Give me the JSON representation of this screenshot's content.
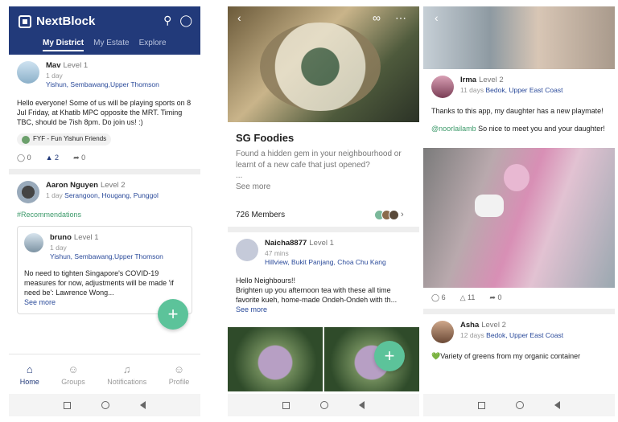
{
  "app": {
    "logo_text": "NextBlock",
    "tabs": [
      "My District",
      "My Estate",
      "Explore"
    ],
    "nav": [
      "Home",
      "Groups",
      "Notifications",
      "Profile"
    ],
    "fab_label": "+"
  },
  "phone1": {
    "post1": {
      "name": "Mav",
      "level": "Level 1",
      "time": "1 day",
      "location": "Yishun, Sembawang,Upper Thomson",
      "text": "Hello everyone! Some of us will be playing sports on 8 Jul Friday, at Khatib MPC opposite the MRT. Timing TBC, should be 7ish 8pm. Do join us! :)",
      "group": "FYF - Fun Yishun Friends",
      "comments": "0",
      "likes": "2",
      "shares": "0"
    },
    "post2": {
      "name": "Aaron Nguyen",
      "level": "Level 2",
      "time": "1 day",
      "location": "Serangoon, Hougang, Punggol",
      "hashtag": "#Recommendations",
      "inner": {
        "name": "bruno",
        "level": "Level 1",
        "time": "1 day",
        "location": "Yishun, Sembawang,Upper Thomson",
        "text": "No need to tighten Singapore's COVID-19 measures for now, adjustments will be made 'if need be': Lawrence Wong...",
        "see_more": "See more"
      }
    }
  },
  "phone2": {
    "group_title": "SG Foodies",
    "group_desc": "Found a hidden gem in your neighbourhood or learnt of a new cafe that just opened?",
    "ellipsis": "...",
    "see_more": "See more",
    "members": "726 Members",
    "post": {
      "name": "Naicha8877",
      "level": "Level 1",
      "time": "47 mins",
      "location": "Hillview, Bukit Panjang, Choa Chu Kang",
      "text1": "Hello Neighbours!!",
      "text2": "Brighten up you afternoon tea with these all time favorite kueh, home-made Ondeh-Ondeh with th...",
      "see_more": "See more"
    }
  },
  "phone3": {
    "post1": {
      "name": "Irma",
      "level": "Level 2",
      "time": "11 days",
      "location": "Bedok, Upper East Coast",
      "text": "Thanks to this app, my daughter has a new playmate!",
      "mention": "@noorlailamb",
      "reply": " So nice to meet you and your daughter!",
      "comments": "6",
      "likes": "11",
      "shares": "0"
    },
    "post2": {
      "name": "Asha",
      "level": "Level 2",
      "time": "12 days",
      "location": "Bedok, Upper East Coast",
      "text": "💚Variety of greens from my organic container"
    }
  },
  "colors": {
    "brand": "#223a7a",
    "accent": "#5cc39a",
    "link": "#2a4a9a",
    "hashtag": "#3c9a6a"
  }
}
